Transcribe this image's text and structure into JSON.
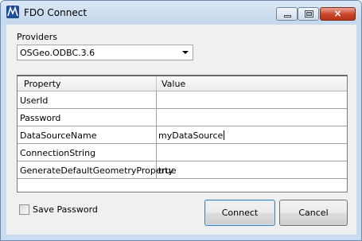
{
  "window": {
    "title": "FDO Connect",
    "controls": {
      "minimize": "minimize",
      "maximize": "maximize",
      "close": "×"
    }
  },
  "providers": {
    "label": "Providers",
    "selected": "OSGeo.ODBC.3.6"
  },
  "grid": {
    "headers": [
      "Property",
      "Value"
    ],
    "rows": [
      {
        "property": "UserId",
        "value": ""
      },
      {
        "property": "Password",
        "value": ""
      },
      {
        "property": "DataSourceName",
        "value": "myDataSource"
      },
      {
        "property": "ConnectionString",
        "value": ""
      },
      {
        "property": "GenerateDefaultGeometryProperty",
        "value": "true"
      }
    ]
  },
  "save_password": {
    "label": "Save Password",
    "checked": false
  },
  "buttons": {
    "connect": "Connect",
    "cancel": "Cancel"
  }
}
